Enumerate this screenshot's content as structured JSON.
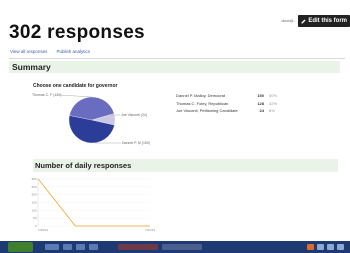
{
  "header": {
    "user_email": "olson@...",
    "edit_button": "Edit this form"
  },
  "title": "302 responses",
  "links": [
    "View all responses",
    "Publish analytics"
  ],
  "summary_label": "Summary",
  "question": "Choose one candidate for governor",
  "pie_labels": {
    "top": "Thomas C. F (130)",
    "right": "Joe Visconti (24)",
    "bottom": "Dannel P. M (150)"
  },
  "results": [
    {
      "name": "Dannel P. Malloy, Democrat",
      "count": "150",
      "pct": "50%"
    },
    {
      "name": "Thomas C. Foley, Republican",
      "count": "128",
      "pct": "42%"
    },
    {
      "name": "Joe Visconti, Petitioning Candidate",
      "count": "24",
      "pct": "8%"
    }
  ],
  "daily_label": "Number of daily responses",
  "chart_data": {
    "type": "line",
    "title": "Number of daily responses",
    "x": [
      "7/28/14",
      "7/29/14",
      "7/30/14",
      "7/31/14"
    ],
    "values": [
      302,
      0,
      0,
      0
    ],
    "x_tick_labels": [
      "7/28/14",
      "7/31/14"
    ],
    "y_tick_labels": [
      "300",
      "250",
      "200",
      "150",
      "100",
      "50",
      "0"
    ],
    "ylim": [
      0,
      300
    ],
    "color": "#f0a020"
  },
  "pie_data": {
    "type": "pie",
    "slices": [
      {
        "label": "Dannel P. Malloy, Democrat",
        "value": 150,
        "color": "#2b3c99"
      },
      {
        "label": "Thomas C. Foley, Republican",
        "value": 128,
        "color": "#6a6cbf"
      },
      {
        "label": "Joe Visconti, Petitioning Candidate",
        "value": 24,
        "color": "#c9c9e3"
      }
    ]
  },
  "colors": {
    "section_bg": "#e9f3e7",
    "link": "#3a5ea8",
    "taskbar": "#1d3a72"
  }
}
